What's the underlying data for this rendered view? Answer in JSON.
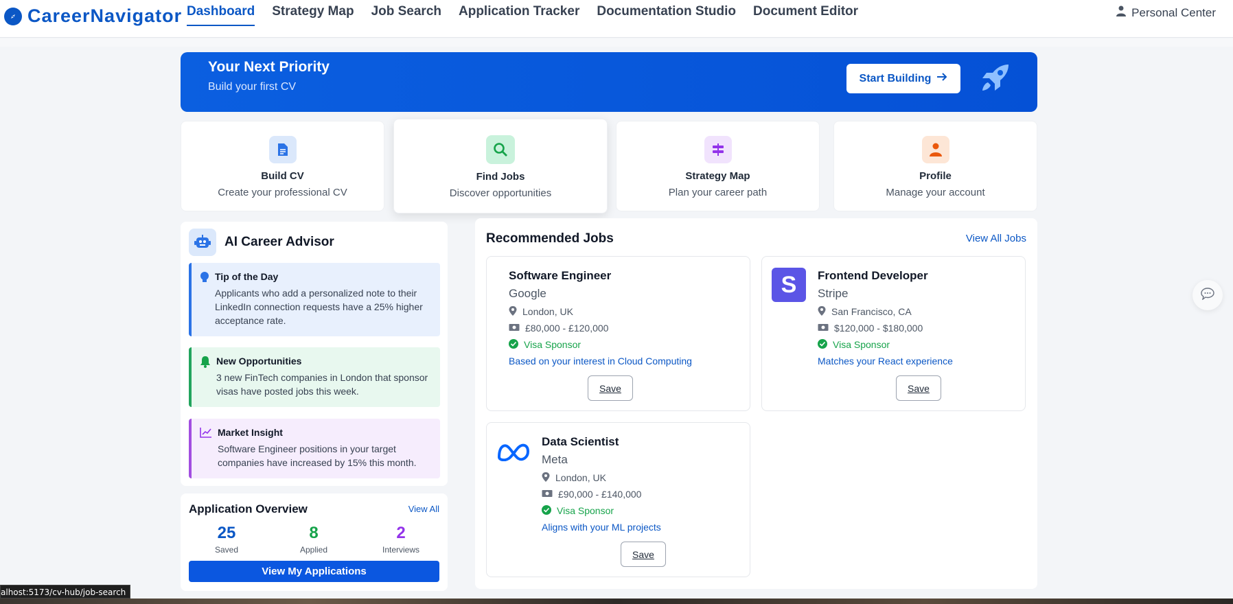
{
  "app": {
    "brand": "CareerNavigator"
  },
  "nav": {
    "items": [
      {
        "label": "Dashboard",
        "active": true
      },
      {
        "label": "Strategy Map"
      },
      {
        "label": "Job Search"
      },
      {
        "label": "Application Tracker"
      },
      {
        "label": "Documentation Studio"
      },
      {
        "label": "Document Editor"
      }
    ],
    "personal": "Personal Center"
  },
  "banner": {
    "title": "Your Next Priority",
    "subtitle": "Build your first CV",
    "button": "Start Building"
  },
  "quick_cards": [
    {
      "title": "Build CV",
      "subtitle": "Create your professional CV",
      "icon": "document-icon",
      "color": "#2b73e6"
    },
    {
      "title": "Find Jobs",
      "subtitle": "Discover opportunities",
      "icon": "search-icon",
      "color": "#16a34a"
    },
    {
      "title": "Strategy Map",
      "subtitle": "Plan your career path",
      "icon": "signpost-icon",
      "color": "#9333ea"
    },
    {
      "title": "Profile",
      "subtitle": "Manage your account",
      "icon": "user-icon",
      "color": "#ea580c"
    }
  ],
  "advisor": {
    "title": "AI Career Advisor",
    "tips": [
      {
        "title": "Tip of the Day",
        "body": "Applicants who add a personalized note to their LinkedIn connection requests have a 25% higher acceptance rate."
      },
      {
        "title": "New Opportunities",
        "body": "3 new FinTech companies in London that sponsor visas have posted jobs this week."
      },
      {
        "title": "Market Insight",
        "body": "Software Engineer positions in your target companies have increased by 15% this month."
      }
    ]
  },
  "overview": {
    "title": "Application Overview",
    "link": "View All",
    "stats": [
      {
        "value": "25",
        "label": "Saved",
        "color": "#0b57c5"
      },
      {
        "value": "8",
        "label": "Applied",
        "color": "#16a34a"
      },
      {
        "value": "2",
        "label": "Interviews",
        "color": "#9333ea"
      }
    ],
    "button": "View My Applications"
  },
  "jobs": {
    "title": "Recommended Jobs",
    "link": "View All Jobs",
    "save_label": "Save",
    "list": [
      {
        "title": "Software Engineer",
        "company": "Google",
        "location": "London, UK",
        "salary": "£80,000 - £120,000",
        "sponsor": "Visa Sponsor",
        "reason": "Based on your interest in Cloud Computing",
        "logo": "none"
      },
      {
        "title": "Frontend Developer",
        "company": "Stripe",
        "location": "San Francisco, CA",
        "salary": "$120,000 - $180,000",
        "sponsor": "Visa Sponsor",
        "reason": "Matches your React experience",
        "logo": "S"
      },
      {
        "title": "Data Scientist",
        "company": "Meta",
        "location": "London, UK",
        "salary": "£90,000 - £140,000",
        "sponsor": "Visa Sponsor",
        "reason": "Aligns with your ML projects",
        "logo": "meta-logo"
      }
    ]
  },
  "status_url": "alhost:5173/cv-hub/job-search"
}
